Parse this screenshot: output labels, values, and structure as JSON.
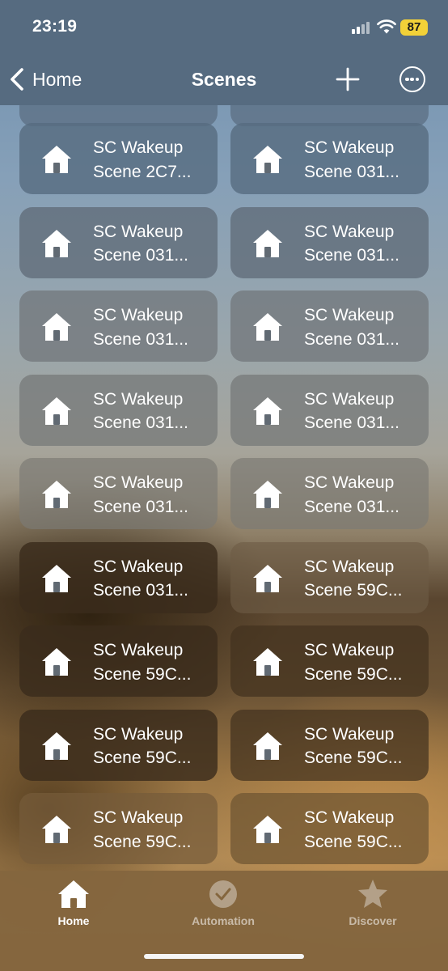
{
  "status": {
    "time": "23:19",
    "battery": "87",
    "battery_color": "#f2d138",
    "icons": [
      "signal-icon",
      "wifi-icon"
    ]
  },
  "nav": {
    "back_label": "Home",
    "title": "Scenes",
    "add_icon": "plus-icon",
    "more_icon": "ellipsis-circle-icon"
  },
  "scenes": [
    {
      "line1": "SC Wakeup",
      "line2": "Scene 2C7..."
    },
    {
      "line1": "SC Wakeup",
      "line2": "Scene 031..."
    },
    {
      "line1": "SC Wakeup",
      "line2": "Scene 031..."
    },
    {
      "line1": "SC Wakeup",
      "line2": "Scene 031..."
    },
    {
      "line1": "SC Wakeup",
      "line2": "Scene 031..."
    },
    {
      "line1": "SC Wakeup",
      "line2": "Scene 031..."
    },
    {
      "line1": "SC Wakeup",
      "line2": "Scene 031..."
    },
    {
      "line1": "SC Wakeup",
      "line2": "Scene 031..."
    },
    {
      "line1": "SC Wakeup",
      "line2": "Scene 031..."
    },
    {
      "line1": "SC Wakeup",
      "line2": "Scene 031..."
    },
    {
      "line1": "SC Wakeup",
      "line2": "Scene 031..."
    },
    {
      "line1": "SC Wakeup",
      "line2": "Scene 59C..."
    },
    {
      "line1": "SC Wakeup",
      "line2": "Scene 59C..."
    },
    {
      "line1": "SC Wakeup",
      "line2": "Scene 59C..."
    },
    {
      "line1": "SC Wakeup",
      "line2": "Scene 59C..."
    },
    {
      "line1": "SC Wakeup",
      "line2": "Scene 59C..."
    },
    {
      "line1": "SC Wakeup",
      "line2": "Scene 59C..."
    },
    {
      "line1": "SC Wakeup",
      "line2": "Scene 59C..."
    }
  ],
  "tabs": [
    {
      "label": "Home",
      "icon": "house-icon",
      "active": true
    },
    {
      "label": "Automation",
      "icon": "clock-check-icon",
      "active": false
    },
    {
      "label": "Discover",
      "icon": "star-icon",
      "active": false
    }
  ]
}
